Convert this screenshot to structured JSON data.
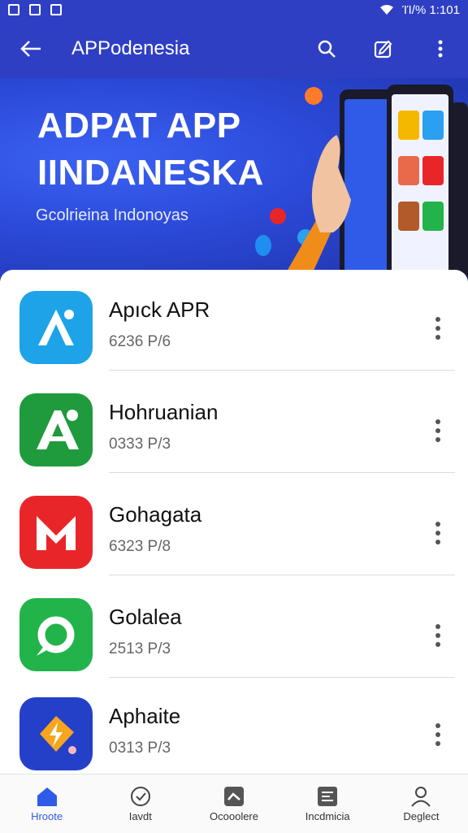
{
  "status_bar": {
    "text": "ΊΊ/%  1:101"
  },
  "app_bar": {
    "title": "APPodenesia",
    "icons": [
      "back-arrow-icon",
      "search-icon",
      "edit-icon",
      "more-vert-icon"
    ]
  },
  "banner": {
    "title": "ADPAT APP\nIINDANESKA",
    "subtitle": "Gcolrieina Indonoyas"
  },
  "apps": [
    {
      "name": "Apıck APR",
      "meta": "6236 Ρ/6",
      "icon": "a-logo-icon",
      "color": "#1fa3e8"
    },
    {
      "name": "Hohruanian",
      "meta": "0333 Ρ/3",
      "icon": "a-logo-icon",
      "color": "#1f9a3c"
    },
    {
      "name": "Gohagata",
      "meta": "6323 Ρ/8",
      "icon": "m-logo-icon",
      "color": "#e8262a"
    },
    {
      "name": "Golalea",
      "meta": "2513 Ρ/3",
      "icon": "ring-logo-icon",
      "color": "#22b34a"
    },
    {
      "name": "Aphaite",
      "meta": "0313 Ρ/3",
      "icon": "bolt-logo-icon",
      "color": "#2540c8"
    }
  ],
  "bottom_nav": [
    {
      "label": "Hroote",
      "icon": "home-icon",
      "active": true
    },
    {
      "label": "Iavdt",
      "icon": "check-circle-icon",
      "active": false
    },
    {
      "label": "Ocooolere",
      "icon": "chart-icon",
      "active": false
    },
    {
      "label": "Incdmicia",
      "icon": "list-icon",
      "active": false
    },
    {
      "label": "Deglect",
      "icon": "person-icon",
      "active": false
    }
  ],
  "colors": {
    "primary": "#2f3fc4",
    "accent": "#2f5be8"
  }
}
